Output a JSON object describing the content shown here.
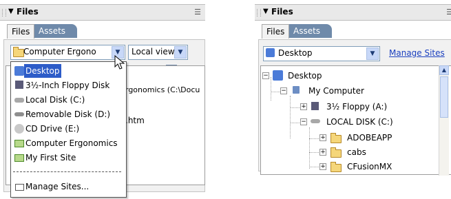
{
  "left": {
    "panel_title": "Files",
    "tabs": [
      {
        "label": "Files"
      },
      {
        "label": "Assets"
      }
    ],
    "site_dropdown_value": "Computer Ergono",
    "view_dropdown_value": "Local view",
    "path_fragment": "rgonomics (C:\\Docu",
    "file_fragment": ".htm",
    "menu_items": [
      {
        "label": "Desktop",
        "icon": "desktop-icon",
        "selected": true
      },
      {
        "label": "3½-Inch Floppy Disk",
        "icon": "floppy-icon"
      },
      {
        "label": "Local Disk (C:)",
        "icon": "hard-disk-icon"
      },
      {
        "label": "Removable Disk (D:)",
        "icon": "removable-disk-icon"
      },
      {
        "label": "CD Drive (E:)",
        "icon": "cd-drive-icon"
      },
      {
        "label": "Computer Ergonomics",
        "icon": "site-folder-icon"
      },
      {
        "label": "My First Site",
        "icon": "site-folder-icon"
      }
    ],
    "menu_separator": "-------------------------",
    "manage_sites": "Manage Sites..."
  },
  "right": {
    "panel_title": "Files",
    "tabs": [
      {
        "label": "Files"
      },
      {
        "label": "Assets"
      }
    ],
    "site_dropdown_value": "Desktop",
    "manage_sites_link": "Manage Sites",
    "tree": [
      {
        "label": "Desktop",
        "level": 0,
        "toggle": "−",
        "icon": "desktop-icon"
      },
      {
        "label": "My Computer",
        "level": 1,
        "toggle": "−",
        "icon": "computer-icon"
      },
      {
        "label": "3½ Floppy (A:)",
        "level": 2,
        "toggle": "+",
        "icon": "floppy-icon"
      },
      {
        "label": "LOCAL DISK (C:)",
        "level": 2,
        "toggle": "−",
        "icon": "hard-disk-icon"
      },
      {
        "label": "ADOBEAPP",
        "level": 3,
        "toggle": "+",
        "icon": "folder-icon"
      },
      {
        "label": "cabs",
        "level": 3,
        "toggle": "+",
        "icon": "folder-icon"
      },
      {
        "label": "CFusionMX",
        "level": 3,
        "toggle": "+",
        "icon": "folder-icon"
      }
    ]
  },
  "colors": {
    "accent": "#2d5cc8",
    "tab_inactive": "#6f8aaa",
    "link": "#1a3fbf"
  }
}
